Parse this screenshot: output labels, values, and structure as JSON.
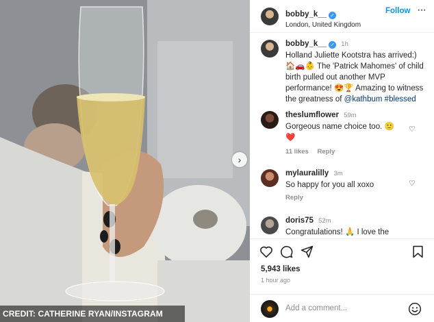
{
  "photo": {
    "credit": "CREDIT: CATHERINE RYAN/INSTAGRAM",
    "next_icon": "chevron-right-icon"
  },
  "header": {
    "username": "bobby_k__",
    "location": "London, United Kingdom",
    "follow_label": "Follow",
    "more_label": "···"
  },
  "caption": {
    "username": "bobby_k__",
    "time": "1h",
    "text": "Holland Juliette Kootstra has arrived:) 🏠🚗👶 The 'Patrick Mahomes' of child birth pulled out another MVP performance! 😍🏆 Amazing to witness the greatness of ",
    "mention": "@kathbum",
    "hashtag": "#blessed"
  },
  "comments": [
    {
      "username": "theslumflower",
      "time": "59m",
      "text": "Gorgeous name choice too. 🙂",
      "extra": "❤️",
      "likes": "11 likes",
      "reply": "Reply"
    },
    {
      "username": "mylauralilly",
      "time": "3m",
      "text": "So happy for you all xoxo",
      "reply": "Reply"
    },
    {
      "username": "doris75",
      "time": "52m",
      "text": "Congratulations! 🙏 I love the"
    }
  ],
  "stats": {
    "likes": "5,943 likes",
    "ago": "1 hour ago"
  },
  "add_comment": {
    "placeholder": "Add a comment..."
  },
  "colors": {
    "accent": "#0095f6",
    "verified": "#3897f0",
    "muted": "#8e8e8e",
    "heart_red": "#ed4956"
  }
}
